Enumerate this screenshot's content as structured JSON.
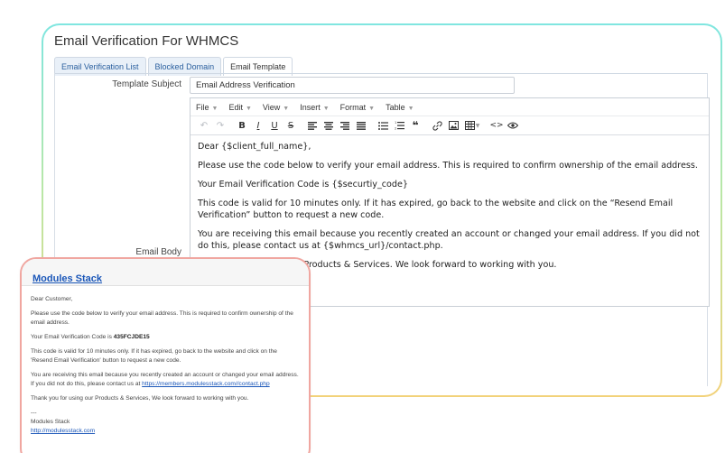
{
  "page": {
    "title": "Email Verification For WHMCS"
  },
  "tabs": [
    {
      "label": "Email Verification List"
    },
    {
      "label": "Blocked Domain"
    },
    {
      "label": "Email Template"
    }
  ],
  "form": {
    "subject_label": "Template Subject",
    "subject_value": "Email Address Verification",
    "body_label": "Email Body"
  },
  "editor": {
    "menu": [
      "File",
      "Edit",
      "View",
      "Insert",
      "Format",
      "Table"
    ],
    "toolbar_icons": [
      "undo-icon",
      "redo-icon",
      "bold-icon",
      "italic-icon",
      "underline-icon",
      "strikethrough-icon",
      "align-left-icon",
      "align-center-icon",
      "align-right-icon",
      "align-justify-icon",
      "bullet-list-icon",
      "numbered-list-icon",
      "blockquote-icon",
      "link-icon",
      "image-icon",
      "table-icon",
      "code-icon",
      "preview-icon"
    ],
    "paragraphs": [
      "Dear {$client_full_name},",
      "Please use the code below to verify your email address. This is required to confirm ownership of the email address.",
      "Your Email Verification Code is {$securtiy_code}",
      "This code is valid for 10 minutes only. If it has expired, go back to the website and click on the “Resend Email Verification” button to request a new code.",
      "You are receiving this email because you recently created an account or changed your email address. If you did not do this, please contact us at {$whmcs_url}/contact.php.",
      "Thank you for using our Products & Services. We look forward to working with you."
    ]
  },
  "preview": {
    "brand": "Modules Stack",
    "greeting": "Dear Customer,",
    "p1": "Please use the code below to verify your email address. This is required to confirm ownership of the email address.",
    "code_prefix": "Your Email Verification Code is ",
    "code": "435FCJDE15",
    "p3": "This code is valid for 10 minutes only. If it has expired, go back to the website and click on the 'Resend Email Verification' button to request a new code.",
    "p4_prefix": "You are receiving this email because you recently created an account or changed your email address. If you did not do this, please contact us at ",
    "p4_link": "https://members.modulesstack.com//contact.php",
    "p5": "Thank you for using our Products & Services, We look forward to working with you.",
    "sig_dash": "---",
    "sig_name": "Modules Stack",
    "sig_link": "http://modulesstack.com"
  }
}
